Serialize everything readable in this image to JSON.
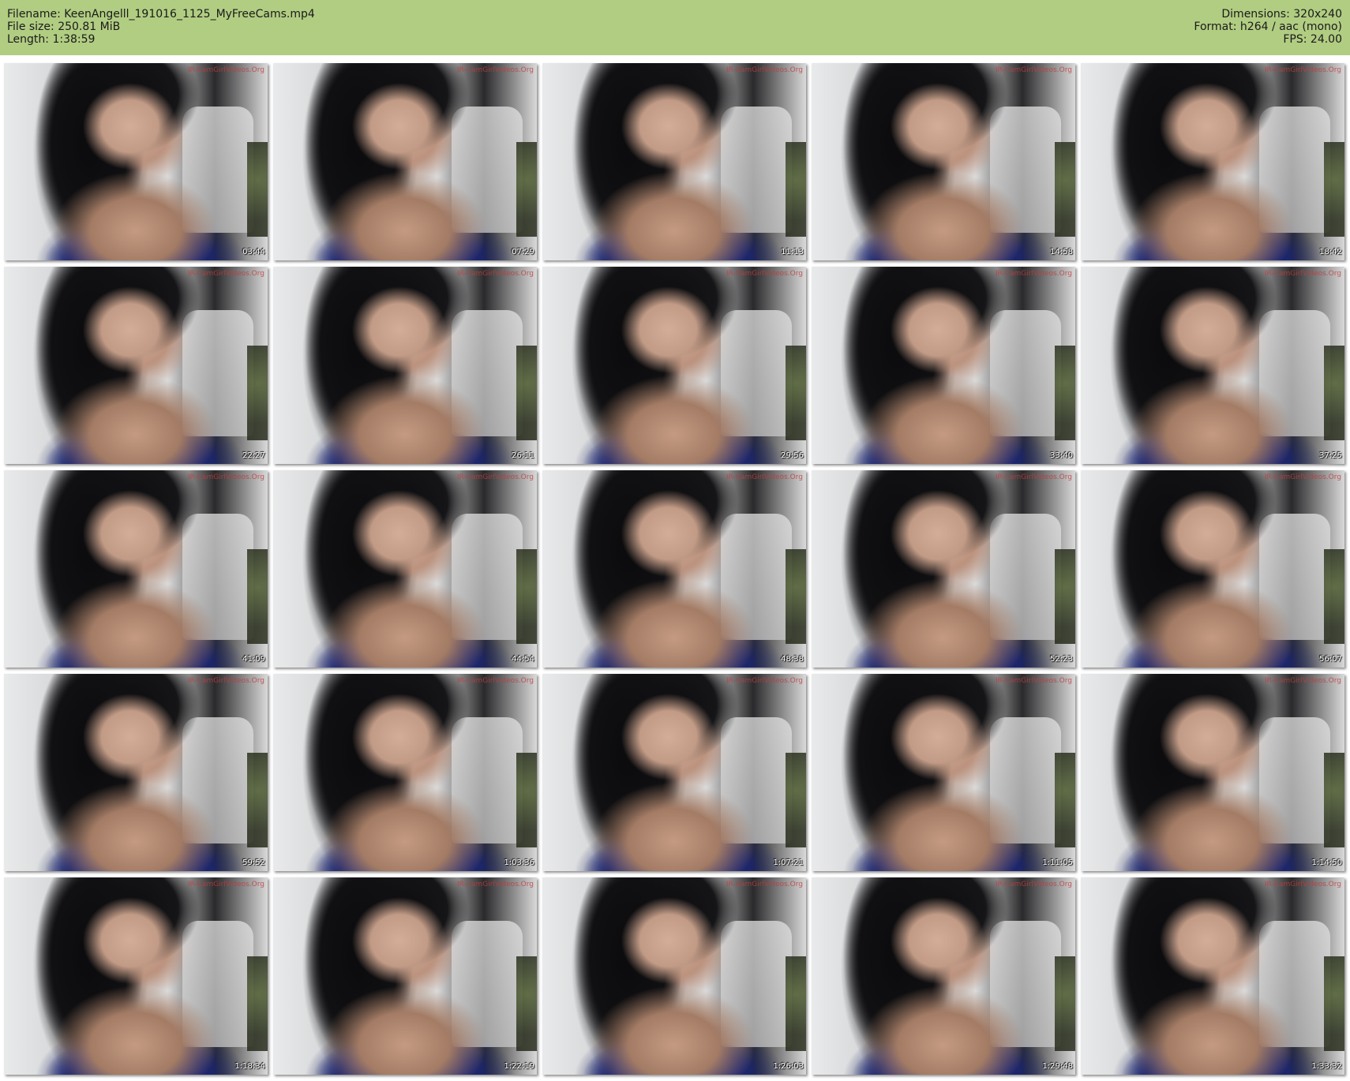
{
  "header": {
    "filename": "Filename: KeenAngelll_191016_1125_MyFreeCams.mp4",
    "filesize": "File size: 250.81 MiB",
    "length": "Length: 1:38:59",
    "dimensions": "Dimensions: 320x240",
    "format": "Format: h264 / aac (mono)",
    "fps": "FPS: 24.00"
  },
  "watermark": "IR-CamGirlVideos.Org",
  "thumbnails": [
    {
      "time": "03:44"
    },
    {
      "time": "07:29"
    },
    {
      "time": "11:13"
    },
    {
      "time": "14:58"
    },
    {
      "time": "18:42"
    },
    {
      "time": "22:27"
    },
    {
      "time": "26:11"
    },
    {
      "time": "29:56"
    },
    {
      "time": "33:40"
    },
    {
      "time": "37:25"
    },
    {
      "time": "41:09"
    },
    {
      "time": "44:54"
    },
    {
      "time": "48:38"
    },
    {
      "time": "52:23"
    },
    {
      "time": "56:07"
    },
    {
      "time": "59:52"
    },
    {
      "time": "1:03:36"
    },
    {
      "time": "1:07:21"
    },
    {
      "time": "1:11:05"
    },
    {
      "time": "1:14:50"
    },
    {
      "time": "1:18:34"
    },
    {
      "time": "1:22:19"
    },
    {
      "time": "1:26:03"
    },
    {
      "time": "1:29:48"
    },
    {
      "time": "1:33:32"
    }
  ]
}
